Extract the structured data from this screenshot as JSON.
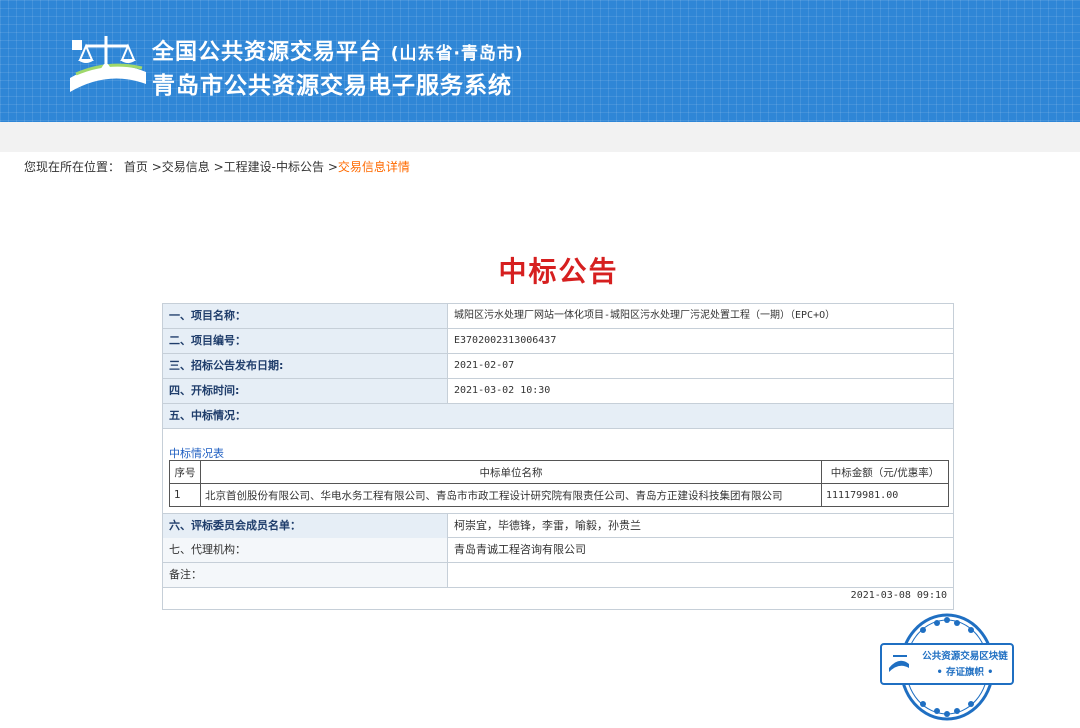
{
  "header": {
    "title_line1": "全国公共资源交易平台",
    "title_line1_sub": "(山东省·青岛市)",
    "title_line2": "青岛市公共资源交易电子服务系统",
    "logo_icon": "scales-of-justice-logo-icon"
  },
  "breadcrumb": {
    "prefix": "您现在所在位置：",
    "items": [
      "首页",
      "交易信息",
      "工程建设-中标公告"
    ],
    "separator": ">",
    "current": "交易信息详情"
  },
  "notice": {
    "title": "中标公告",
    "rows": [
      {
        "label": "一、项目名称：",
        "value": "城阳区污水处理厂网站一体化项目-城阳区污水处理厂污泥处置工程（一期）（EPC+O）"
      },
      {
        "label": "二、项目编号：",
        "value": "E3702002313006437"
      },
      {
        "label": "三、招标公告发布日期:",
        "value": "2021-02-07"
      },
      {
        "label": "四、开标时间:",
        "value": "2021-03-02 10:30"
      },
      {
        "label": "五、中标情况：",
        "value": ""
      }
    ],
    "table_caption": "中标情况表",
    "table": {
      "headers": [
        "序号",
        "中标单位名称",
        "中标金额（元/优惠率）"
      ],
      "rows": [
        [
          "1",
          "北京首创股份有限公司、华电水务工程有限公司、青岛市市政工程设计研究院有限责任公司、青岛方正建设科技集团有限公司",
          "111179981.00"
        ]
      ]
    },
    "rows2": [
      {
        "label": "六、评标委员会成员名单：",
        "value": "柯崇宜，毕德锋，李雷，喻毅，孙贵兰"
      },
      {
        "label": "七、代理机构：",
        "value": "青岛青诚工程咨询有限公司"
      },
      {
        "label": "备注：",
        "value": ""
      }
    ],
    "datetime": "2021-03-08 09:10"
  },
  "stamp": {
    "line1": "公共资源交易区块链",
    "line2": "存证旗帜",
    "color": "#1f6fc2"
  },
  "colors": {
    "header_bg": "#2f86d6",
    "headline": "#d61f1f",
    "breadcrumb_current": "#ff6a00"
  }
}
